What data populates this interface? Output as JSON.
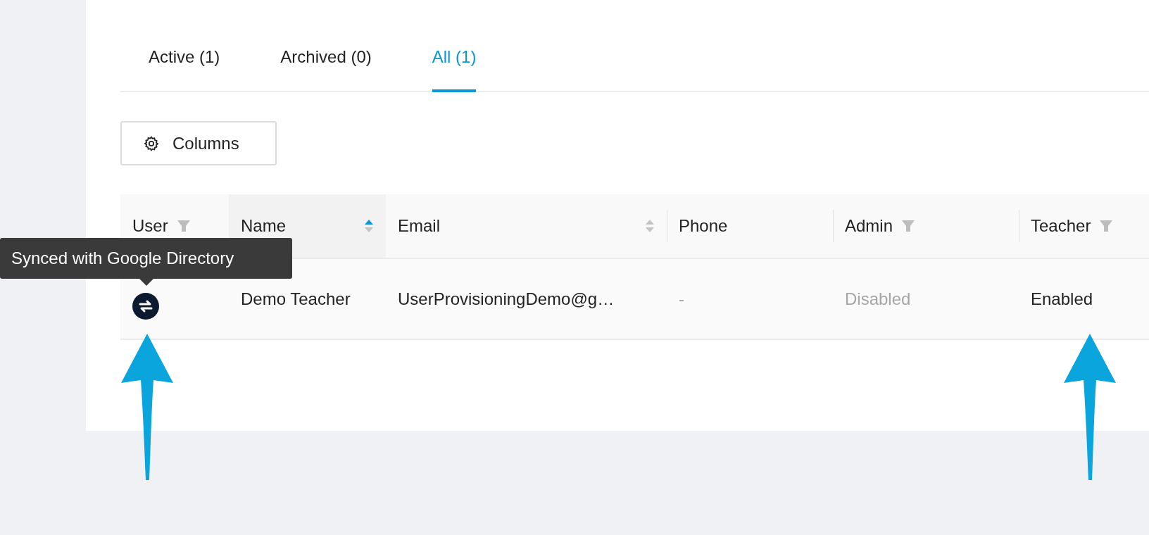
{
  "tabs": [
    {
      "label": "Active (1)",
      "selected": false
    },
    {
      "label": "Archived (0)",
      "selected": false
    },
    {
      "label": "All (1)",
      "selected": true
    }
  ],
  "columns_button": {
    "label": "Columns"
  },
  "table": {
    "columns": [
      {
        "label": "User",
        "filter": true
      },
      {
        "label": "Name",
        "sortable": true,
        "sorted": true
      },
      {
        "label": "Email",
        "sortable": true,
        "sorted": false
      },
      {
        "label": "Phone"
      },
      {
        "label": "Admin",
        "filter": true
      },
      {
        "label": "Teacher",
        "filter": true
      }
    ],
    "rows": [
      {
        "cells": [
          {
            "kind": "icon",
            "synced": true
          },
          {
            "kind": "text",
            "text": "Demo Teacher",
            "dimmed": false
          },
          {
            "kind": "text",
            "text": "UserProvisioningDemo@g…",
            "dimmed": false
          },
          {
            "kind": "text",
            "text": "-",
            "dimmed": true
          },
          {
            "kind": "text",
            "text": "Disabled",
            "dimmed": true
          },
          {
            "kind": "text",
            "text": "Enabled",
            "dimmed": false
          }
        ]
      }
    ]
  },
  "tooltip": {
    "text": "Synced with Google Directory"
  }
}
